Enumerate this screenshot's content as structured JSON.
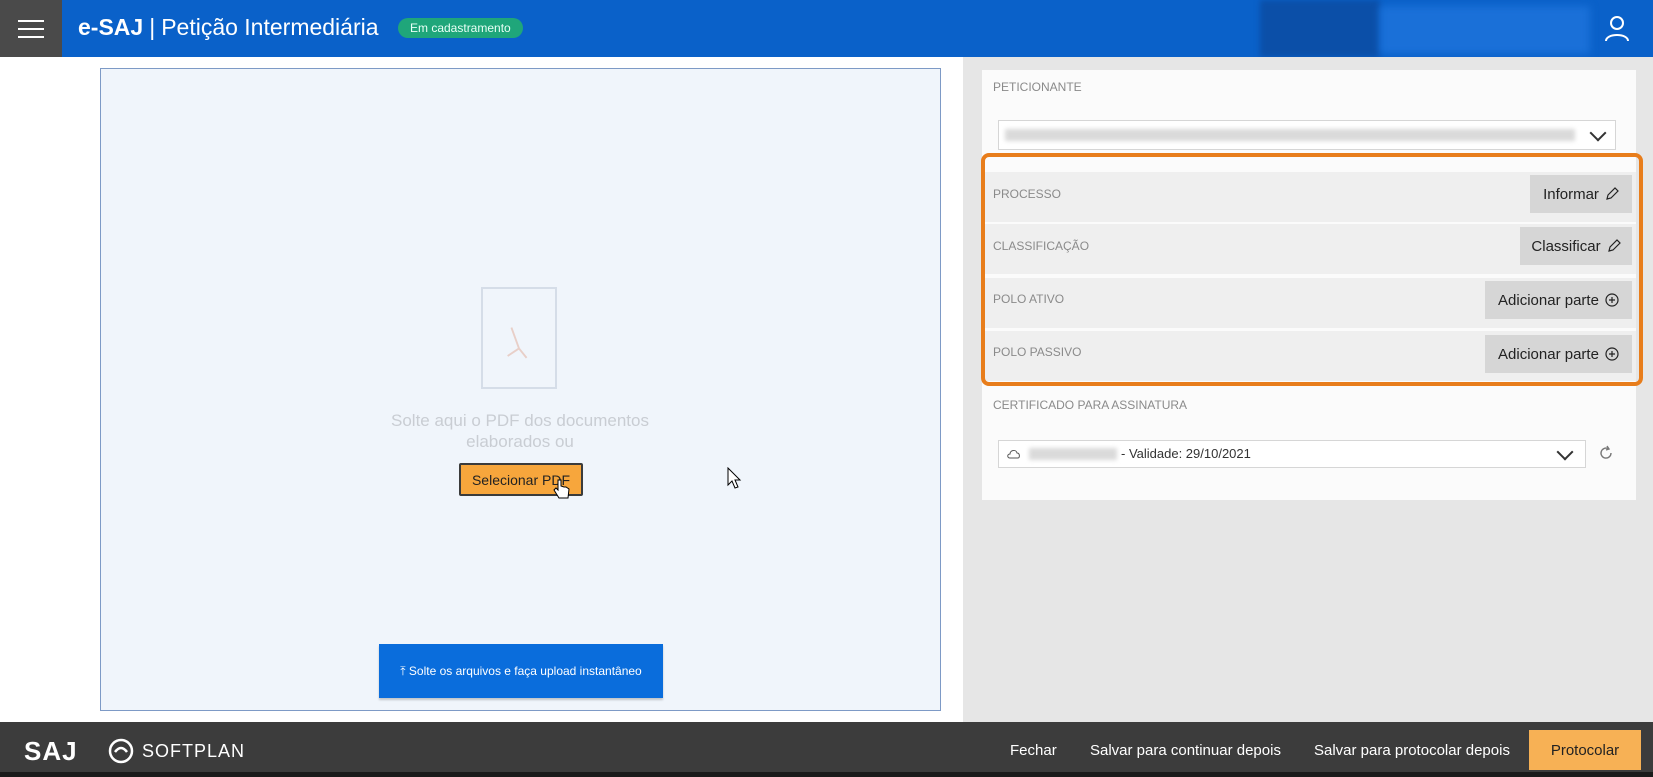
{
  "header": {
    "app_name": "e-SAJ",
    "separator": "|",
    "page_title": "Petição Intermediária",
    "status_badge": "Em cadastramento"
  },
  "dropzone": {
    "instruction": "Solte aqui o PDF dos documentos elaborados ou",
    "select_button": "Selecionar PDF",
    "upload_button": "⤒ Solte os arquivos e faça upload instantâneo"
  },
  "form": {
    "peticionante_label": "PETICIONANTE",
    "processo_label": "PROCESSO",
    "processo_button": "Informar",
    "classificacao_label": "CLASSIFICAÇÃO",
    "classificacao_button": "Classificar",
    "polo_ativo_label": "POLO ATIVO",
    "polo_ativo_button": "Adicionar parte",
    "polo_passivo_label": "POLO PASSIVO",
    "polo_passivo_button": "Adicionar parte",
    "certificado_label": "CERTIFICADO PARA ASSINATURA",
    "certificado_value": "- Validade: 29/10/2021"
  },
  "footer": {
    "saj_logo": "SAJ",
    "softplan_logo": "SOFTPLAN",
    "fechar": "Fechar",
    "salvar_continuar": "Salvar para continuar depois",
    "salvar_protocolar": "Salvar para protocolar depois",
    "protocolar": "Protocolar"
  },
  "colors": {
    "header_blue": "#0a61c9",
    "accent_orange": "#f7a63c",
    "highlight_orange": "#e87d1b",
    "status_green": "#1fa67a"
  }
}
